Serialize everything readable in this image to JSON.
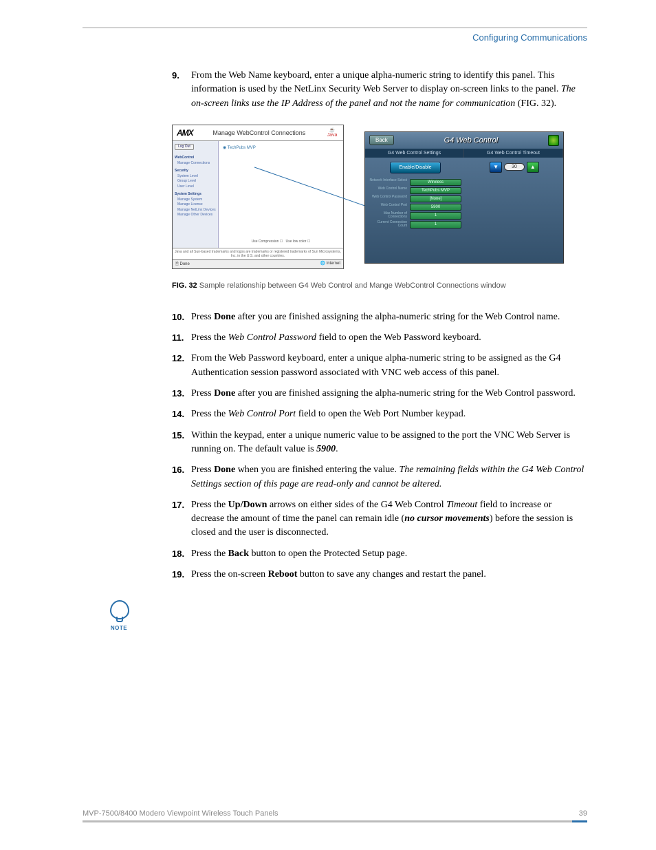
{
  "header": {
    "title": "Configuring Communications"
  },
  "steps": {
    "s9": {
      "n": "9.",
      "pre": "From the Web Name keyboard, enter a unique alpha-numeric string to identify this panel. This information is used by the NetLinx Security Web Server to display on-screen links to the panel. ",
      "italic": "The on-screen links use the IP Address of the panel and not the name for communication",
      "post": " (FIG. 32)."
    },
    "s10": {
      "n": "10.",
      "a": "Press ",
      "b": "Done",
      "c": " after you are finished assigning the alpha-numeric string for the Web Control name."
    },
    "s11": {
      "n": "11.",
      "a": "Press the ",
      "i": "Web Control Password",
      "c": " field to open the Web Password keyboard."
    },
    "s12": {
      "n": "12.",
      "t": "From the Web Password keyboard, enter a unique alpha-numeric string to be assigned as the G4 Authentication session password associated with VNC web access of this panel."
    },
    "s13": {
      "n": "13.",
      "a": "Press ",
      "b": "Done",
      "c": " after you are finished assigning the alpha-numeric string for the Web Control password."
    },
    "s14": {
      "n": "14.",
      "a": "Press the ",
      "i": "Web Control Port",
      "c": " field to open the Web Port Number keypad."
    },
    "s15": {
      "n": "15.",
      "a": "Within the keypad, enter a unique numeric value to be assigned to the port the VNC Web Server is running on. The default value is ",
      "bi": "5900",
      "c": "."
    },
    "s16": {
      "n": "16.",
      "a": "Press ",
      "b": "Done",
      "c": " when you are finished entering the value. ",
      "i": "The remaining fields within the G4 Web Control Settings section of this page are read-only and cannot be altered."
    },
    "s17": {
      "n": "17.",
      "a": "Press the ",
      "b": "Up/Down",
      "c": " arrows on either sides of the G4 Web Control ",
      "i": "Timeout",
      "d": " field to increase or decrease the amount of time the panel can remain idle (",
      "bi": "no cursor movements",
      "e": ") before the session is closed and the user is disconnected."
    },
    "s18": {
      "n": "18.",
      "a": "Press the ",
      "b": "Back",
      "c": " button to open the Protected Setup page."
    },
    "s19": {
      "n": "19.",
      "a": "Press the on-screen ",
      "b": "Reboot",
      "c": " button to save any changes and restart the panel."
    }
  },
  "figure": {
    "caption_b": "FIG. 32",
    "caption_t": "  Sample relationship between G4 Web Control and Mange WebControl Connections window",
    "left": {
      "logo": "AMX",
      "title": "Manage WebControl Connections",
      "java": "Java",
      "logoff": "Log Out",
      "side": {
        "h1": "WebControl",
        "i1": "Manage Connections",
        "h2": "Security",
        "i2a": "System Level",
        "i2b": "Group Level",
        "i2c": "User Level",
        "h3": "System Settings",
        "i3a": "Manage System",
        "i3b": "Manage License",
        "i3c": "Manage NetLinx Devices",
        "i3d": "Manage Other Devices"
      },
      "link": "TechPubs MVP",
      "compress": "Use Compression",
      "lowcolor": "Use low color",
      "foot1": "Java and all Sun-based trademarks and logos are trademarks or registered trademarks of Sun Microsystems, Inc. in the U.S. and other countries.",
      "status_l": "Done",
      "status_r": "Internet"
    },
    "right": {
      "back": "Back",
      "title": "G4 Web Control",
      "sub_l": "G4 Web Control Settings",
      "sub_r": "G4 Web Control Timeout",
      "enable": "Enable/Disable",
      "timeout": "30",
      "rows": {
        "r1l": "Network Interface Select",
        "r1v": "Wireless",
        "r2l": "Web Control Name",
        "r2v": "TechPubs MVP",
        "r3l": "Web Control Password",
        "r3v": "[None]",
        "r4l": "Web Control Port",
        "r4v": "5900",
        "r5l": "Max Number of Connections",
        "r5v": "1",
        "r6l": "Current Connection Count",
        "r6v": "1"
      }
    }
  },
  "note": "NOTE",
  "footer": {
    "left": "MVP-7500/8400 Modero Viewpoint Wireless Touch Panels",
    "right": "39"
  }
}
